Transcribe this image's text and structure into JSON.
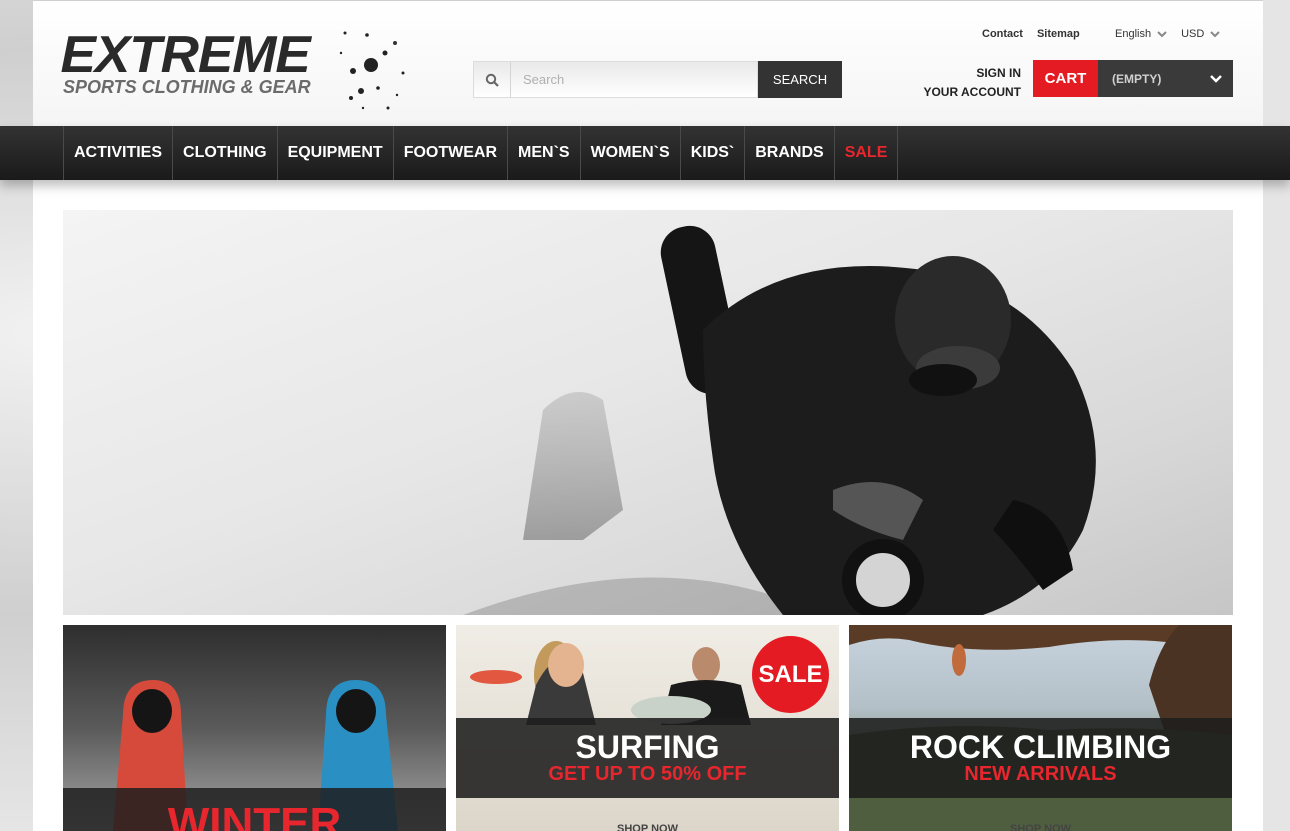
{
  "brand": {
    "title": "EXTREME",
    "subtitle": "SPORTS CLOTHING & GEAR"
  },
  "top_links": {
    "contact": "Contact",
    "sitemap": "Sitemap"
  },
  "selectors": {
    "language": "English",
    "currency": "USD"
  },
  "search": {
    "placeholder": "Search",
    "button_label": "SEARCH"
  },
  "account": {
    "sign_in": "SIGN IN",
    "your_account": "YOUR ACCOUNT"
  },
  "cart": {
    "label": "CART",
    "status": "(EMPTY)"
  },
  "nav": {
    "items": [
      "ACTIVITIES",
      "CLOTHING",
      "EQUIPMENT",
      "FOOTWEAR",
      "MEN`S",
      "WOMEN`S",
      "KIDS`",
      "BRANDS",
      "SALE"
    ]
  },
  "banners": {
    "winter": {
      "title": "WINTER"
    },
    "surfing": {
      "badge": "SALE",
      "title": "SURFING",
      "subtitle": "GET UP TO 50% OFF",
      "cta": "SHOP NOW"
    },
    "climbing": {
      "title": "ROCK CLIMBING",
      "subtitle": "NEW ARRIVALS",
      "cta": "SHOP NOW"
    }
  },
  "colors": {
    "accent_red": "#e41b23",
    "nav_dark": "#222222",
    "text_dark": "#2a2a2a"
  }
}
